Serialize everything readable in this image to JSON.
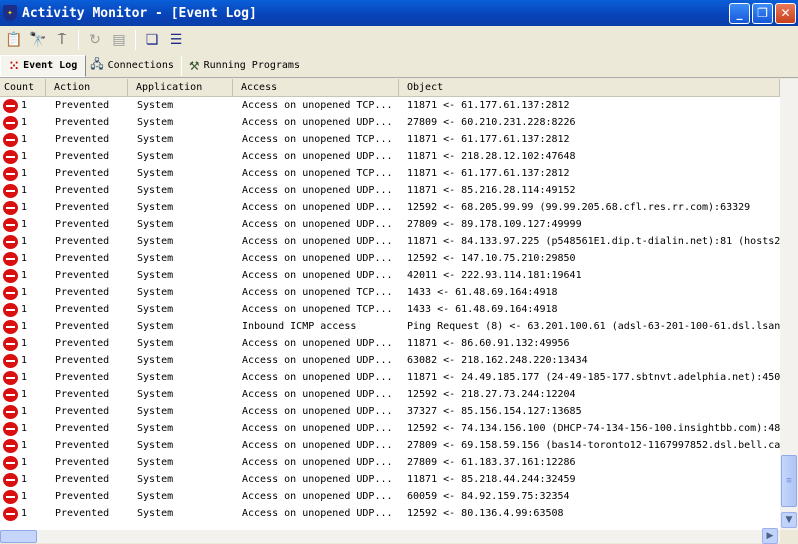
{
  "window": {
    "title": "Activity Monitor - [Event Log]"
  },
  "toolbar": {
    "icons": [
      "properties-icon",
      "find-icon",
      "network-icon",
      "refresh-icon",
      "export-icon",
      "cascade-icon",
      "tile-icon"
    ]
  },
  "tabs": [
    {
      "label": "Event Log",
      "icon": "event-log-icon",
      "active": true
    },
    {
      "label": "Connections",
      "icon": "connections-icon"
    },
    {
      "label": "Running Programs",
      "icon": "running-programs-icon"
    }
  ],
  "columns": [
    "Count",
    "Action",
    "Application",
    "Access",
    "Object"
  ],
  "rows": [
    [
      "1",
      "Prevented",
      "System",
      "Access on unopened TCP...",
      "11871 <- 61.177.61.137:2812"
    ],
    [
      "1",
      "Prevented",
      "System",
      "Access on unopened UDP...",
      "27809 <- 60.210.231.228:8226"
    ],
    [
      "1",
      "Prevented",
      "System",
      "Access on unopened TCP...",
      "11871 <- 61.177.61.137:2812"
    ],
    [
      "1",
      "Prevented",
      "System",
      "Access on unopened UDP...",
      "11871 <- 218.28.12.102:47648"
    ],
    [
      "1",
      "Prevented",
      "System",
      "Access on unopened TCP...",
      "11871 <- 61.177.61.137:2812"
    ],
    [
      "1",
      "Prevented",
      "System",
      "Access on unopened UDP...",
      "11871 <- 85.216.28.114:49152"
    ],
    [
      "1",
      "Prevented",
      "System",
      "Access on unopened UDP...",
      "12592 <- 68.205.99.99 (99.99.205.68.cfl.res.rr.com):63329"
    ],
    [
      "1",
      "Prevented",
      "System",
      "Access on unopened UDP...",
      "27809 <- 89.178.109.127:49999"
    ],
    [
      "1",
      "Prevented",
      "System",
      "Access on unopened UDP...",
      "11871 <- 84.133.97.225 (p548561E1.dip.t-dialin.net):81 (hosts2"
    ],
    [
      "1",
      "Prevented",
      "System",
      "Access on unopened UDP...",
      "12592 <- 147.10.75.210:29850"
    ],
    [
      "1",
      "Prevented",
      "System",
      "Access on unopened UDP...",
      "42011 <- 222.93.114.181:19641"
    ],
    [
      "1",
      "Prevented",
      "System",
      "Access on unopened TCP...",
      "1433 <- 61.48.69.164:4918"
    ],
    [
      "1",
      "Prevented",
      "System",
      "Access on unopened TCP...",
      "1433 <- 61.48.69.164:4918"
    ],
    [
      "1",
      "Prevented",
      "System",
      "Inbound ICMP access",
      "Ping Request (8) <- 63.201.100.61 (adsl-63-201-100-61.dsl.lsan"
    ],
    [
      "1",
      "Prevented",
      "System",
      "Access on unopened UDP...",
      "11871 <- 86.60.91.132:49956"
    ],
    [
      "1",
      "Prevented",
      "System",
      "Access on unopened UDP...",
      "63082 <- 218.162.248.220:13434"
    ],
    [
      "1",
      "Prevented",
      "System",
      "Access on unopened UDP...",
      "11871 <- 24.49.185.177 (24-49-185-177.sbtnvt.adelphia.net):450"
    ],
    [
      "1",
      "Prevented",
      "System",
      "Access on unopened UDP...",
      "12592 <- 218.27.73.244:12204"
    ],
    [
      "1",
      "Prevented",
      "System",
      "Access on unopened UDP...",
      "37327 <- 85.156.154.127:13685"
    ],
    [
      "1",
      "Prevented",
      "System",
      "Access on unopened UDP...",
      "12592 <- 74.134.156.100 (DHCP-74-134-156-100.insightbb.com):48"
    ],
    [
      "1",
      "Prevented",
      "System",
      "Access on unopened UDP...",
      "27809 <- 69.158.59.156 (bas14-toronto12-1167997852.dsl.bell.ca"
    ],
    [
      "1",
      "Prevented",
      "System",
      "Access on unopened UDP...",
      "27809 <- 61.183.37.161:12286"
    ],
    [
      "1",
      "Prevented",
      "System",
      "Access on unopened UDP...",
      "11871 <- 85.218.44.244:32459"
    ],
    [
      "1",
      "Prevented",
      "System",
      "Access on unopened UDP...",
      "60059 <- 84.92.159.75:32354"
    ],
    [
      "1",
      "Prevented",
      "System",
      "Access on unopened UDP...",
      "12592 <- 80.136.4.99:63508"
    ]
  ],
  "colors": {
    "titlebar": "#0842b8",
    "prevented": "#d81010"
  }
}
